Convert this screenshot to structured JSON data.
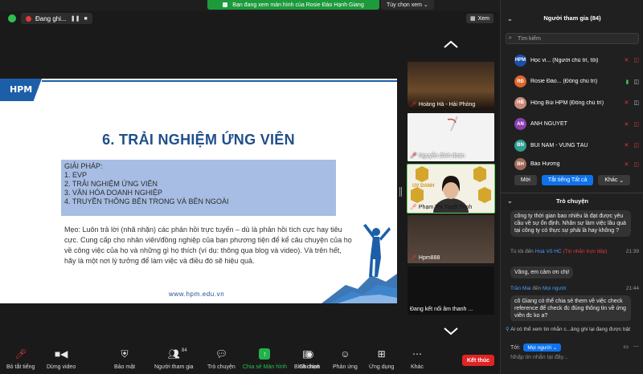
{
  "recording": {
    "label": "Đang ghi..."
  },
  "share_banner": {
    "text": "Bạn đang xem màn hình của Rosie Đào Hạnh Giang",
    "options_label": "Tùy chọn xem"
  },
  "view_button": {
    "label": "Xem"
  },
  "slide": {
    "logo": "HPM",
    "title": "6. TRẢI NGHIỆM ỨNG VIÊN",
    "solution_heading": "GIẢI PHÁP:",
    "solution_items": [
      "1.  EVP",
      "2.  TRẢI NGHIỆM ỨNG VIÊN",
      "3.  VĂN HÓA DOANH NGHIỆP",
      "4.  TRUYỀN THÔNG BÊN TRONG VÀ BÊN NGOÀI"
    ],
    "tip": "Mẹo: Luôn trả lời (nhã nhặn) các phản hồi trực tuyến – dù là phản hồi tích cực hay tiêu cực. Cung cấp cho nhân viên/đồng nghiệp của bạn phương tiện để kể câu chuyện của họ về công việc của họ và những gì họ thích (ví dụ: thông qua blog và video). Và trên hết, hãy là một nơi lý tưởng để làm việc và điều đó sẽ hiệu quả.",
    "url": "www.hpm.edu.vn"
  },
  "gallery": {
    "tiles": [
      {
        "name": "Hoàng Hà - Hải Phòng"
      },
      {
        "name": "Nguyễn đình đoàn"
      },
      {
        "name": "Phạm Thị Tuyết Trinh",
        "logo": "UV DANH"
      },
      {
        "name": "Hpm888"
      },
      {
        "name": "Đang kết nối âm thanh ..."
      }
    ]
  },
  "participants": {
    "header": "Người tham gia (84)",
    "search_placeholder": "Tìm kiếm",
    "list": [
      {
        "initials": "HPM",
        "name": "Học vi... (Người chủ trì, tôi)",
        "color": "#1c4fa8",
        "mic": "muted",
        "cam": "off"
      },
      {
        "initials": "RĐ",
        "name": "Rosie Đào... (Đồng chủ trì)",
        "color": "#e0662b",
        "mic": "active",
        "cam": "on"
      },
      {
        "initials": "HB",
        "name": "Hồng Bùi HPM (Đồng chủ trì)",
        "color": "#c98a7a",
        "mic": "muted",
        "cam": "on"
      },
      {
        "initials": "AN",
        "name": "ANH NGUYET",
        "color": "#8b3fb0",
        "mic": "muted",
        "cam": "off"
      },
      {
        "initials": "BN",
        "name": "BÙI NAM - VŨNG TÀU",
        "color": "#2e9e8f",
        "mic": "muted",
        "cam": "off"
      },
      {
        "initials": "BH",
        "name": "Bảo Hương",
        "color": "#a06a5a",
        "mic": "muted",
        "cam": "off"
      }
    ],
    "invite_label": "Mời",
    "mute_all_label": "Tắt tiếng Tất cả",
    "more_label": "Khác"
  },
  "chat": {
    "header": "Trò chuyện",
    "messages": [
      {
        "text": "công ty thời gian bao nhiêu là đạt được yêu cầu về sự ổn định. Nhân sự làm việc lâu quá tại công ty có thực sự phải là hay không ?"
      },
      {
        "from": "Tú tôi",
        "to_word": "đến",
        "to": "Hoà Võ HC",
        "tag": "(Tin nhắn trực tiếp)",
        "time": "21:39",
        "text": "Vâng, em cảm ơn chị!"
      },
      {
        "from": "Trần Mai",
        "to_word": "đến",
        "to": "Mọi người",
        "time": "21:44",
        "text": "cô Giang có thể chia sẻ them về việc check reference để check đc đúng thông tin về ứng viên đc ko a?"
      }
    ],
    "note": "Ai có thể xem tin nhắn c...ảng ghi lại đang được bật",
    "to_label": "Tới:",
    "to_value": "Mọi người",
    "input_placeholder": "Nhập tin nhắn tại đây..."
  },
  "toolbar": {
    "items": [
      {
        "label": "Bỏ tắt tiếng",
        "icon": "mic-muted-icon"
      },
      {
        "label": "Dừng video",
        "icon": "video-icon"
      },
      {
        "label": "Bảo mật",
        "icon": "shield-icon"
      },
      {
        "label": "Người tham gia",
        "icon": "participants-icon",
        "count": "84"
      },
      {
        "label": "Trò chuyện",
        "icon": "chat-icon"
      },
      {
        "label": "Chia sẻ Màn hình",
        "icon": "share-screen-icon"
      },
      {
        "label": "Bình chọn",
        "icon": "poll-icon"
      },
      {
        "label": "Ghi hình",
        "icon": "record-icon"
      },
      {
        "label": "Phản ứng",
        "icon": "reaction-icon"
      },
      {
        "label": "Ứng dụng",
        "icon": "apps-icon"
      },
      {
        "label": "Khác",
        "icon": "more-icon"
      }
    ],
    "end_label": "Kết thúc"
  },
  "colors": {
    "share_green": "#1d9a3c",
    "end_red": "#e02424",
    "primary_blue": "#0e72ed",
    "slide_title": "#1f4f8b",
    "solution_box": "#a7bde3"
  }
}
